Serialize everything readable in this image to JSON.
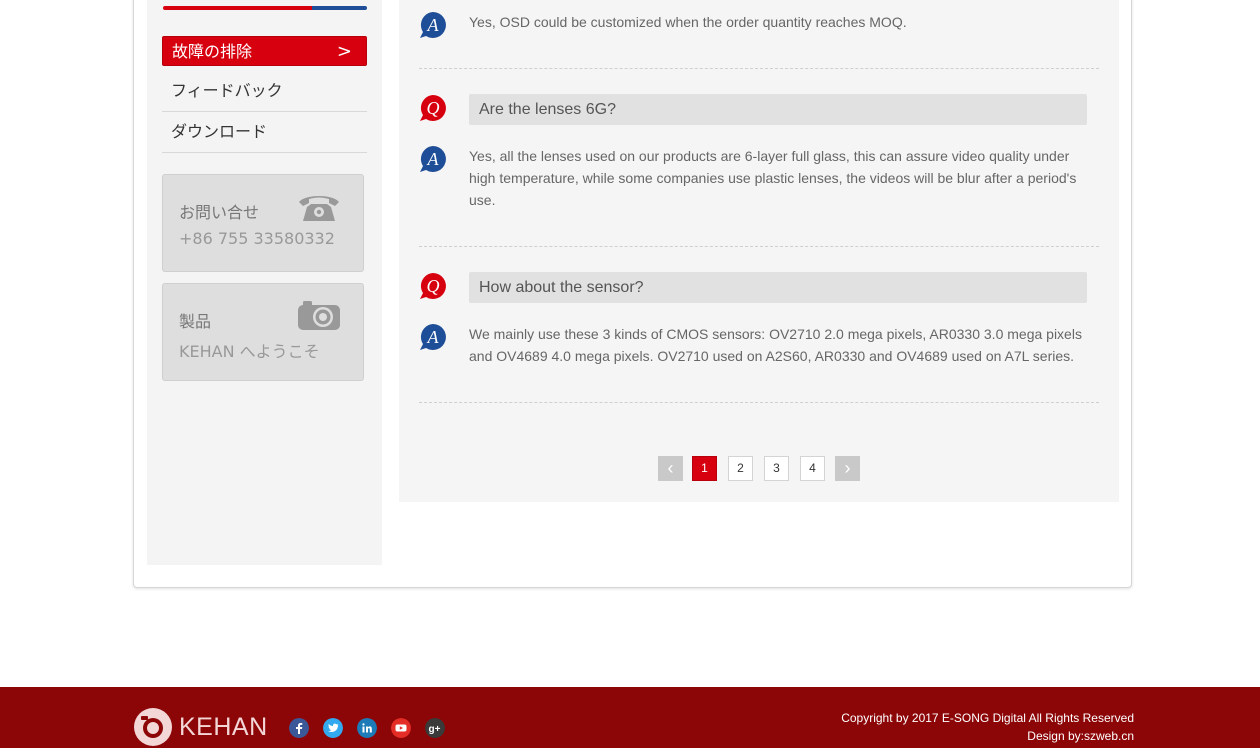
{
  "sidebar": {
    "menu": [
      {
        "label": "故障の排除",
        "active": true
      },
      {
        "label": "フィードバック",
        "active": false
      },
      {
        "label": "ダウンロード",
        "active": false
      }
    ],
    "active_chevron": ">",
    "contact": {
      "title": "お問い合せ",
      "phone": "+86 755 33580332",
      "icon": "telephone-icon"
    },
    "products": {
      "title": "製品",
      "subtitle": "KEHAN へようこそ",
      "icon": "camera-icon"
    }
  },
  "faq": {
    "first_answer": "Yes, OSD could be customized when the order quantity reaches MOQ.",
    "items": [
      {
        "question": "Are the lenses 6G?",
        "answer": "Yes, all the lenses used on our products are 6-layer full glass, this can assure video quality under high temperature, while some companies use plastic lenses, the videos will be blur after a period's use."
      },
      {
        "question": "How about the sensor?",
        "answer": "We mainly use these 3 kinds of CMOS sensors: OV2710 2.0 mega pixels, AR0330 3.0 mega pixels and OV4689 4.0 mega pixels. OV2710 used on A2S60, AR0330 and OV4689 used on A7L series."
      }
    ],
    "q_letter": "Q",
    "a_letter": "A"
  },
  "pagination": {
    "prev": "‹",
    "next": "›",
    "pages": [
      "1",
      "2",
      "3",
      "4"
    ],
    "current": "1"
  },
  "footer": {
    "brand": "KEHAN",
    "social": [
      "facebook-icon",
      "twitter-icon",
      "linkedin-icon",
      "youtube-icon",
      "google-plus-icon"
    ],
    "copyright": "Copyright by 2017 E-SONG Digital All Rights Reserved",
    "design": "Design by:szweb.cn"
  },
  "colors": {
    "accent_red": "#d7000f",
    "accent_blue": "#1f4e99",
    "footer_bg": "#8c0507"
  }
}
